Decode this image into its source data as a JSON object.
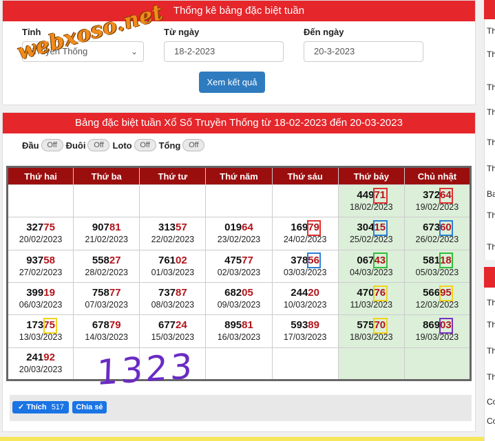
{
  "filter": {
    "title": "Thống kê bảng đặc biệt tuần",
    "province_label": "Tỉnh",
    "province_value": "Truyền Thống",
    "from_label": "Từ ngày",
    "from_value": "18-2-2023",
    "to_label": "Đến ngày",
    "to_value": "20-3-2023",
    "submit_label": "Xem kết quả"
  },
  "watermark": "webxoso.net",
  "main": {
    "title": "Bảng đặc biệt tuần Xổ Số Truyền Thống từ 18-02-2023 đến 20-03-2023",
    "toggles": [
      {
        "label": "Đầu",
        "state": "Off"
      },
      {
        "label": "Đuôi",
        "state": "Off"
      },
      {
        "label": "Loto",
        "state": "Off"
      },
      {
        "label": "Tổng",
        "state": "Off"
      }
    ],
    "headers": [
      "Thứ hai",
      "Thứ ba",
      "Thứ tư",
      "Thứ năm",
      "Thứ sáu",
      "Thứ bảy",
      "Chủ nhật"
    ],
    "rows": [
      [
        null,
        null,
        null,
        null,
        null,
        {
          "pre": "449",
          "tail": "71",
          "date": "18/02/2023"
        },
        {
          "pre": "372",
          "tail": "64",
          "date": "19/02/2023"
        }
      ],
      [
        {
          "pre": "327",
          "tail": "75",
          "date": "20/02/2023"
        },
        {
          "pre": "907",
          "tail": "81",
          "date": "21/02/2023"
        },
        {
          "pre": "313",
          "tail": "57",
          "date": "22/02/2023"
        },
        {
          "pre": "019",
          "tail": "64",
          "date": "23/02/2023"
        },
        {
          "pre": "169",
          "tail": "79",
          "date": "24/02/2023"
        },
        {
          "pre": "304",
          "tail": "15",
          "date": "25/02/2023"
        },
        {
          "pre": "673",
          "tail": "60",
          "date": "26/02/2023"
        }
      ],
      [
        {
          "pre": "937",
          "tail": "58",
          "date": "27/02/2023"
        },
        {
          "pre": "558",
          "tail": "27",
          "date": "28/02/2023"
        },
        {
          "pre": "761",
          "tail": "02",
          "date": "01/03/2023"
        },
        {
          "pre": "475",
          "tail": "77",
          "date": "02/03/2023"
        },
        {
          "pre": "378",
          "tail": "56",
          "date": "03/03/2023"
        },
        {
          "pre": "067",
          "tail": "43",
          "date": "04/03/2023"
        },
        {
          "pre": "581",
          "tail": "18",
          "date": "05/03/2023"
        }
      ],
      [
        {
          "pre": "399",
          "tail": "19",
          "date": "06/03/2023"
        },
        {
          "pre": "758",
          "tail": "77",
          "date": "07/03/2023"
        },
        {
          "pre": "737",
          "tail": "87",
          "date": "08/03/2023"
        },
        {
          "pre": "682",
          "tail": "05",
          "date": "09/03/2023"
        },
        {
          "pre": "244",
          "tail": "20",
          "date": "10/03/2023"
        },
        {
          "pre": "470",
          "tail": "76",
          "date": "11/03/2023"
        },
        {
          "pre": "566",
          "tail": "95",
          "date": "12/03/2023"
        }
      ],
      [
        {
          "pre": "173",
          "tail": "75",
          "date": "13/03/2023"
        },
        {
          "pre": "678",
          "tail": "79",
          "date": "14/03/2023"
        },
        {
          "pre": "677",
          "tail": "24",
          "date": "15/03/2023"
        },
        {
          "pre": "895",
          "tail": "81",
          "date": "16/03/2023"
        },
        {
          "pre": "593",
          "tail": "89",
          "date": "17/03/2023"
        },
        {
          "pre": "575",
          "tail": "70",
          "date": "18/03/2023"
        },
        {
          "pre": "869",
          "tail": "03",
          "date": "19/03/2023"
        }
      ],
      [
        {
          "pre": "241",
          "tail": "92",
          "date": "20/03/2023"
        },
        null,
        null,
        null,
        null,
        null,
        null
      ]
    ],
    "handwritten_note": "1323"
  },
  "social": {
    "like_label": "Thích",
    "like_count": "517",
    "share_label": "Chia sẻ"
  },
  "sidebar": {
    "items": [
      "Th",
      "Th lo",
      "Th",
      "Th lo",
      "Th",
      "Th",
      "Ba",
      "Th th",
      "Th",
      "Th",
      "Th",
      "Th",
      "Th",
      "Co",
      "Co Vi"
    ]
  },
  "colors": {
    "header_red": "#e5262b",
    "table_head": "#9b0e0e",
    "weekend_bg": "#dcefd9",
    "tail_red": "#b3141a",
    "button_blue": "#2f7bbf",
    "facebook_blue": "#1b74e4",
    "marker_red": "#e03030",
    "marker_blue": "#2a7fd4",
    "marker_green": "#2fbf3a",
    "marker_yellow": "#f2d21b",
    "marker_purple": "#7a2fbf"
  }
}
